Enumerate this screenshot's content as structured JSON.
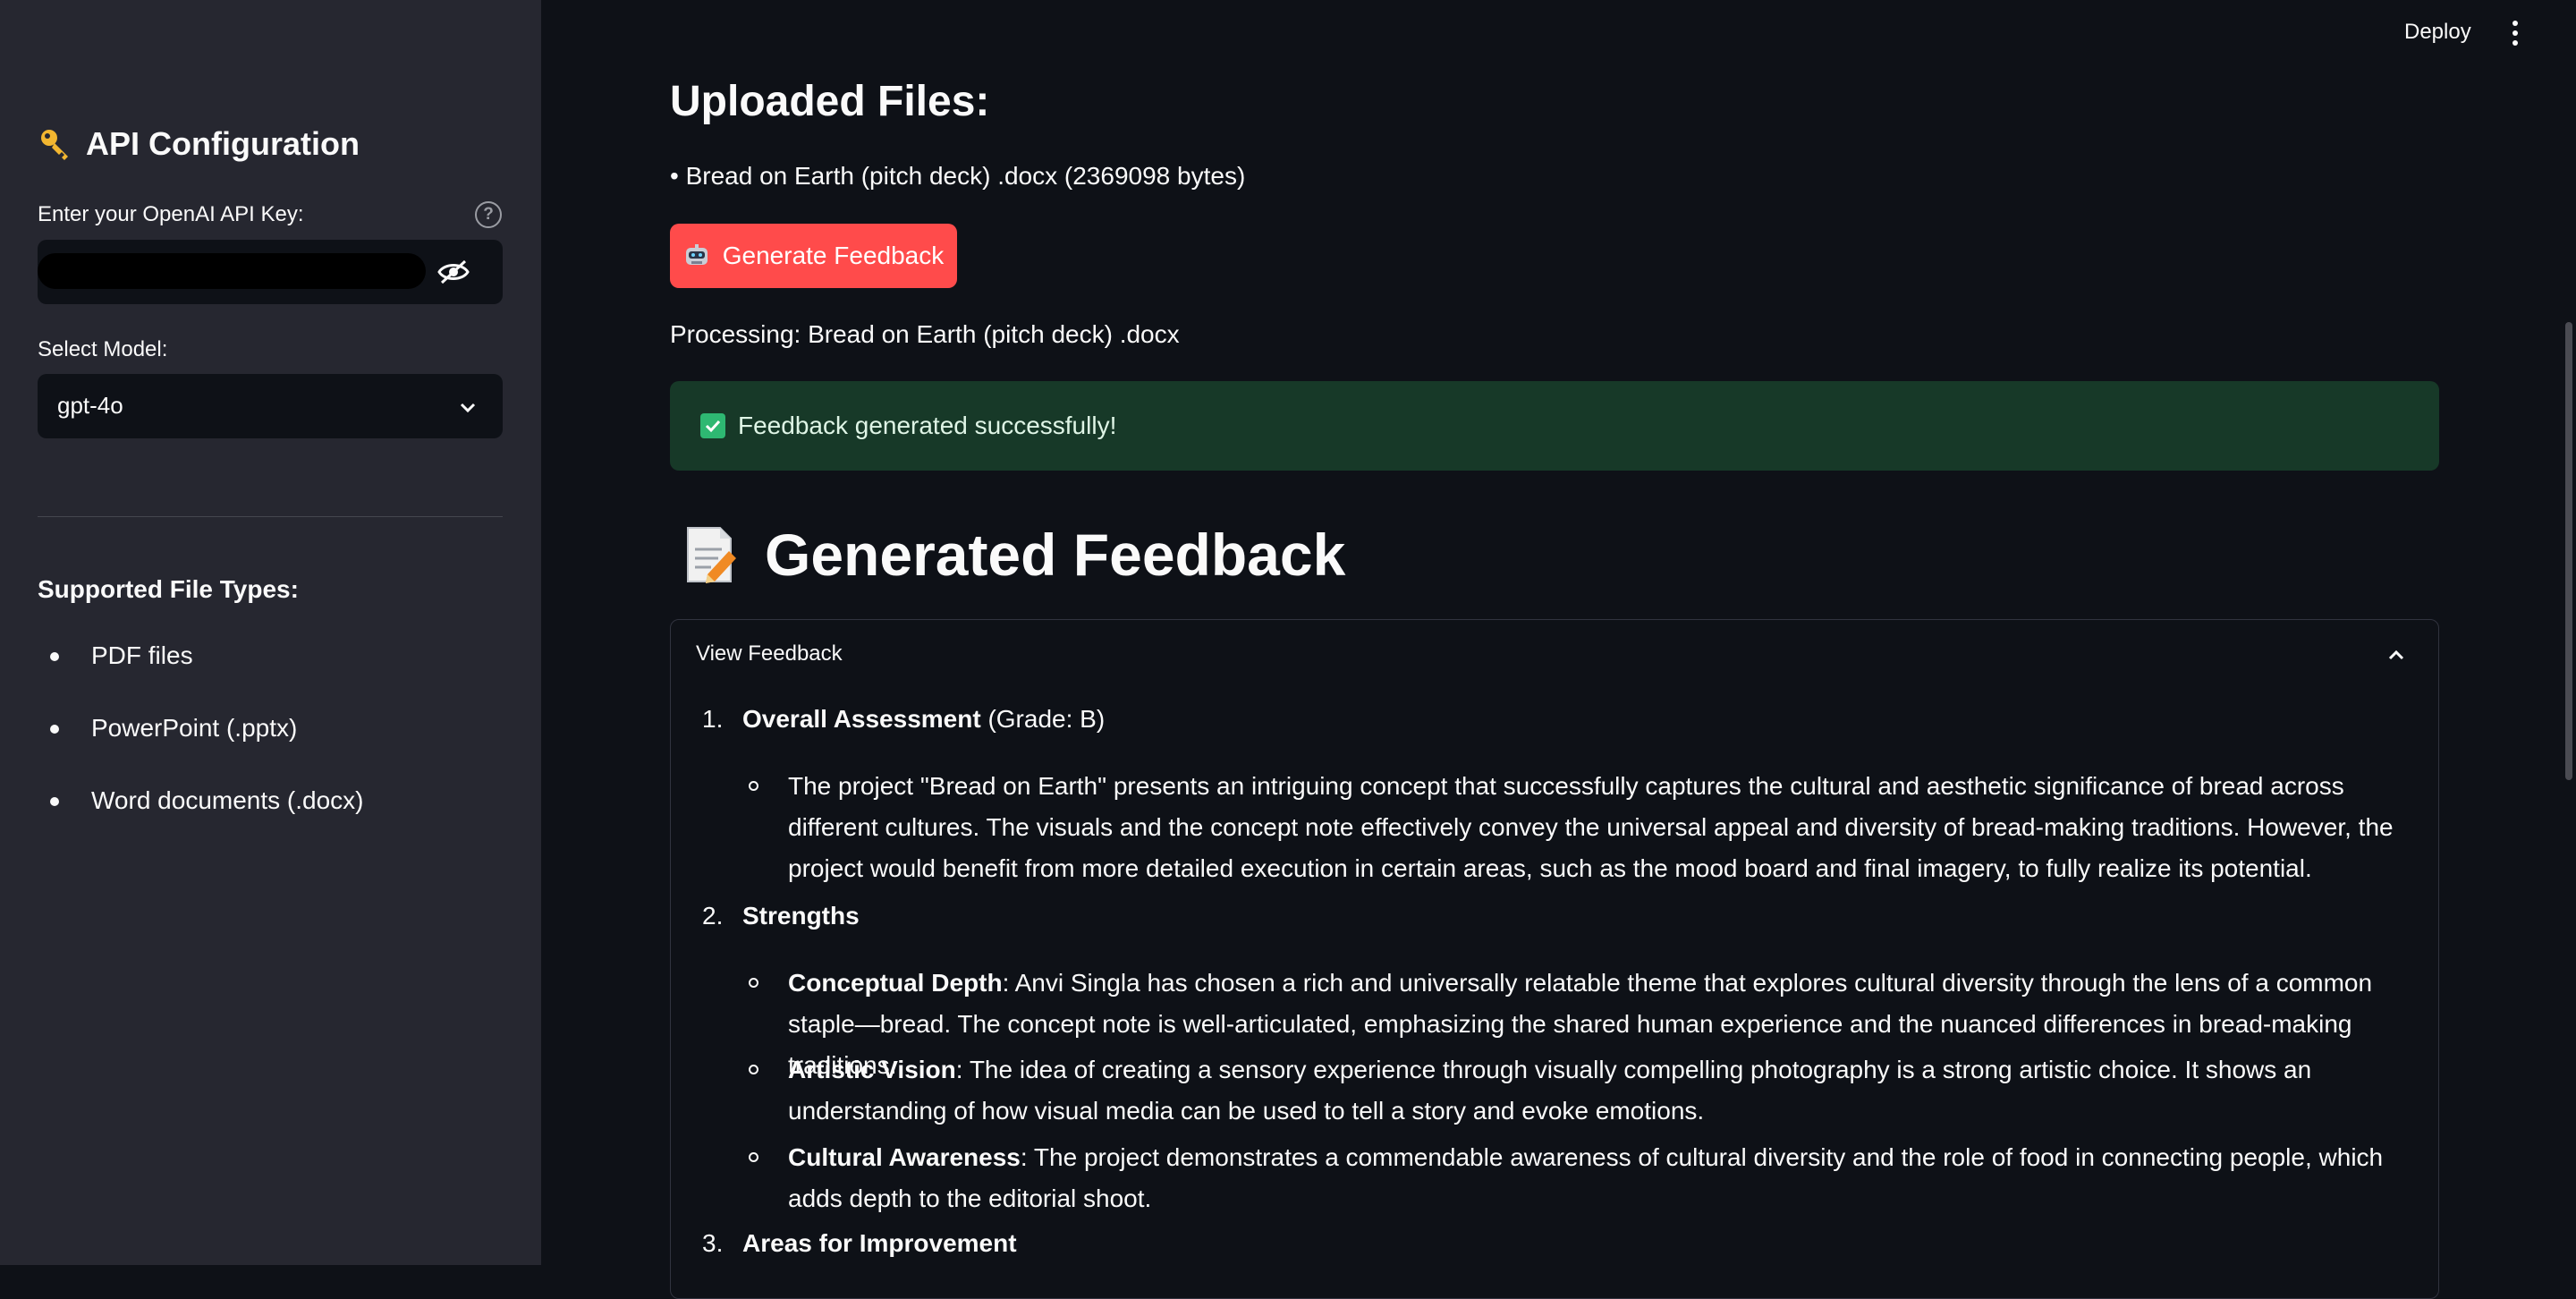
{
  "sidebar": {
    "title": "API Configuration",
    "api_key_label": "Enter your OpenAI API Key:",
    "model_label": "Select Model:",
    "model_value": "gpt-4o",
    "supported_title": "Supported File Types:",
    "file_types": [
      "PDF files",
      "PowerPoint (.pptx)",
      "Word documents (.docx)"
    ]
  },
  "header": {
    "deploy": "Deploy"
  },
  "main": {
    "uploaded_title": "Uploaded Files:",
    "uploaded_item": "• Bread on Earth (pitch deck) .docx (2369098 bytes)",
    "generate_button": "Generate Feedback",
    "processing": "Processing: Bread on Earth (pitch deck) .docx",
    "success": "Feedback generated successfully!",
    "feedback_title": "Generated Feedback",
    "expander_label": "View Feedback"
  },
  "feedback": {
    "s1_num": "1.",
    "s1_title": "Overall Assessment",
    "s1_grade": " (Grade: B)",
    "s1_p1": "The project \"Bread on Earth\" presents an intriguing concept that successfully captures the cultural and aesthetic significance of bread across different cultures. The visuals and the concept note effectively convey the universal appeal and diversity of bread-making traditions. However, the project would benefit from more detailed execution in certain areas, such as the mood board and final imagery, to fully realize its potential.",
    "s2_num": "2.",
    "s2_title": "Strengths",
    "s2_b1_title": "Conceptual Depth",
    "s2_b1_text": ": Anvi Singla has chosen a rich and universally relatable theme that explores cultural diversity through the lens of a common staple—bread. The concept note is well-articulated, emphasizing the shared human experience and the nuanced differences in bread-making traditions.",
    "s2_b2_title": "Artistic Vision",
    "s2_b2_text": ": The idea of creating a sensory experience through visually compelling photography is a strong artistic choice. It shows an understanding of how visual media can be used to tell a story and evoke emotions.",
    "s2_b3_title": "Cultural Awareness",
    "s2_b3_text": ": The project demonstrates a commendable awareness of cultural diversity and the role of food in connecting people, which adds depth to the editorial shoot.",
    "s3_num": "3.",
    "s3_title": "Areas for Improvement"
  },
  "colors": {
    "primary": "#ff4b4b",
    "sidebar_bg": "#262730",
    "main_bg": "#0e1117",
    "success_bg": "#173928"
  }
}
